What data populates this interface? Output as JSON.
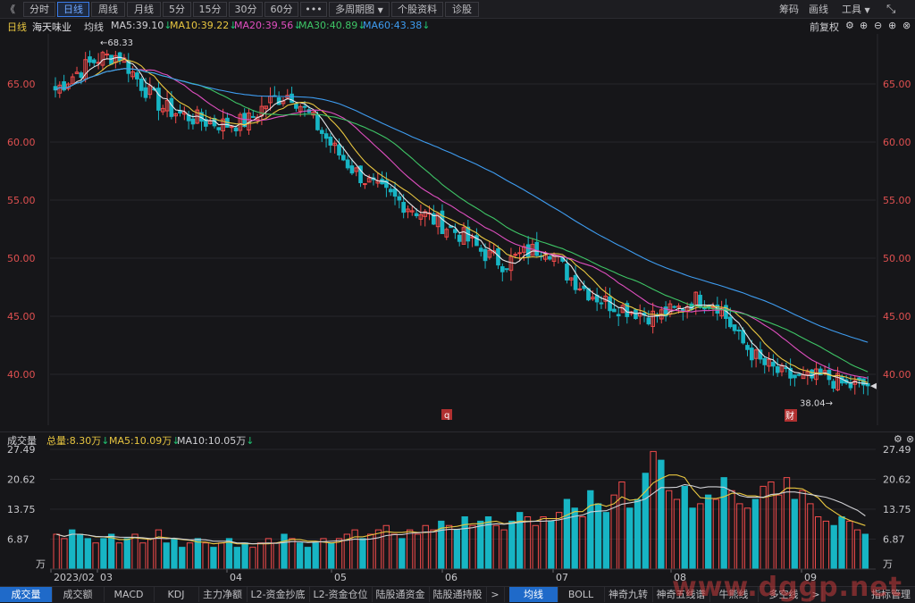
{
  "toolbar": {
    "back_glyph": "《",
    "periods": [
      "分时",
      "日线",
      "周线",
      "月线",
      "5分",
      "15分",
      "30分",
      "60分"
    ],
    "active_period": "日线",
    "more_glyph": "•••",
    "multi_period": "多周期图",
    "stock_info": "个股资料",
    "diagnose": "诊股",
    "right_items": [
      "筹码",
      "画线",
      "工具"
    ]
  },
  "info": {
    "period": "日线",
    "stock_name": "海天味业",
    "avg_label": "均线",
    "ma5": "MA5:39.10",
    "ma10": "MA10:39.22",
    "ma20": "MA20:39.56",
    "ma30": "MA30:40.89",
    "ma60": "MA60:43.38",
    "adjust": "前复权"
  },
  "volume_info": {
    "label": "成交量",
    "total": "总量:8.30万",
    "ma5": "MA5:10.09万",
    "ma10": "MA10:10.05万"
  },
  "colors": {
    "up": "#f24b4b",
    "down": "#17b5c4",
    "ma5": "#e8c640",
    "ma10": "#e04fc0",
    "ma20": "#3ec566",
    "ma30": "#3e9cf0",
    "vol_ma5": "#e8c640",
    "vol_ma10": "#d0d0d4",
    "axis_text": "#e05050"
  },
  "chart_data": [
    {
      "type": "candlestick",
      "title": "海天味业 日线",
      "x_labels": [
        "2023/02",
        "03",
        "04",
        "05",
        "06",
        "07",
        "08",
        "09"
      ],
      "ylim": [
        37,
        69
      ],
      "y_ticks": [
        "65.00",
        "60.00",
        "55.00",
        "50.00",
        "45.00",
        "40.00"
      ],
      "annotations": {
        "high": "68.33",
        "low": "38.04",
        "markers": [
          "q",
          "财"
        ]
      },
      "series": [
        {
          "name": "MA5",
          "last": 39.1
        },
        {
          "name": "MA10",
          "last": 39.22
        },
        {
          "name": "MA20",
          "last": 39.56
        },
        {
          "name": "MA30",
          "last": 40.89
        },
        {
          "name": "MA60",
          "last": 43.38
        }
      ],
      "close_path": [
        64.5,
        66.0,
        67.2,
        67.5,
        65.0,
        63.0,
        62.3,
        61.8,
        61.5,
        61.8,
        63.5,
        64.2,
        62.0,
        59.5,
        57.5,
        56.0,
        55.0,
        54.0,
        53.0,
        52.0,
        50.5,
        49.5,
        50.5,
        51.0,
        48.5,
        47.0,
        46.0,
        45.5,
        45.0,
        45.5,
        46.5,
        46.0,
        43.0,
        41.0,
        40.0,
        39.5,
        39.8,
        39.0,
        39.1
      ]
    },
    {
      "type": "bar",
      "title": "成交量",
      "unit": "万",
      "ylim": [
        0,
        27.49
      ],
      "y_ticks": [
        "27.49",
        "20.62",
        "13.75",
        "6.87"
      ],
      "values": [
        8,
        7,
        9,
        8,
        7,
        6,
        7,
        8,
        6,
        7,
        8,
        6,
        7,
        9,
        6,
        7,
        5,
        6,
        7,
        6,
        5,
        6,
        7,
        5,
        6,
        5,
        6,
        7,
        6,
        8,
        7,
        6,
        5,
        6,
        7,
        6,
        7,
        8,
        9,
        7,
        8,
        9,
        10,
        8,
        7,
        9,
        8,
        10,
        9,
        11,
        10,
        9,
        12,
        10,
        11,
        12,
        10,
        9,
        11,
        13,
        12,
        10,
        12,
        11,
        13,
        16,
        14,
        12,
        18,
        15,
        13,
        17,
        20,
        14,
        16,
        22,
        27,
        25,
        18,
        16,
        19,
        14,
        15,
        17,
        16,
        21,
        18,
        15,
        14,
        16,
        19,
        20,
        17,
        21,
        16,
        18,
        15,
        12,
        11,
        10,
        12,
        11,
        9,
        8
      ]
    }
  ],
  "volume_axis": {
    "unit_label": "万",
    "x_labels": [
      "2023/02",
      "03",
      "04",
      "05",
      "06",
      "07",
      "08",
      "09"
    ]
  },
  "bottom_tabs": {
    "left": [
      "成交量",
      "成交额",
      "MACD",
      "KDJ",
      "主力净额",
      "L2-资金抄底",
      "L2-资金仓位",
      "陆股通资金",
      "陆股通持股"
    ],
    "scroll_glyph": ">",
    "right": [
      "均线",
      "BOLL",
      "神奇九转",
      "神奇五线谱",
      "牛熊线",
      "多空线"
    ],
    "manage": "指标管理"
  },
  "watermark": "www.dggp.net"
}
